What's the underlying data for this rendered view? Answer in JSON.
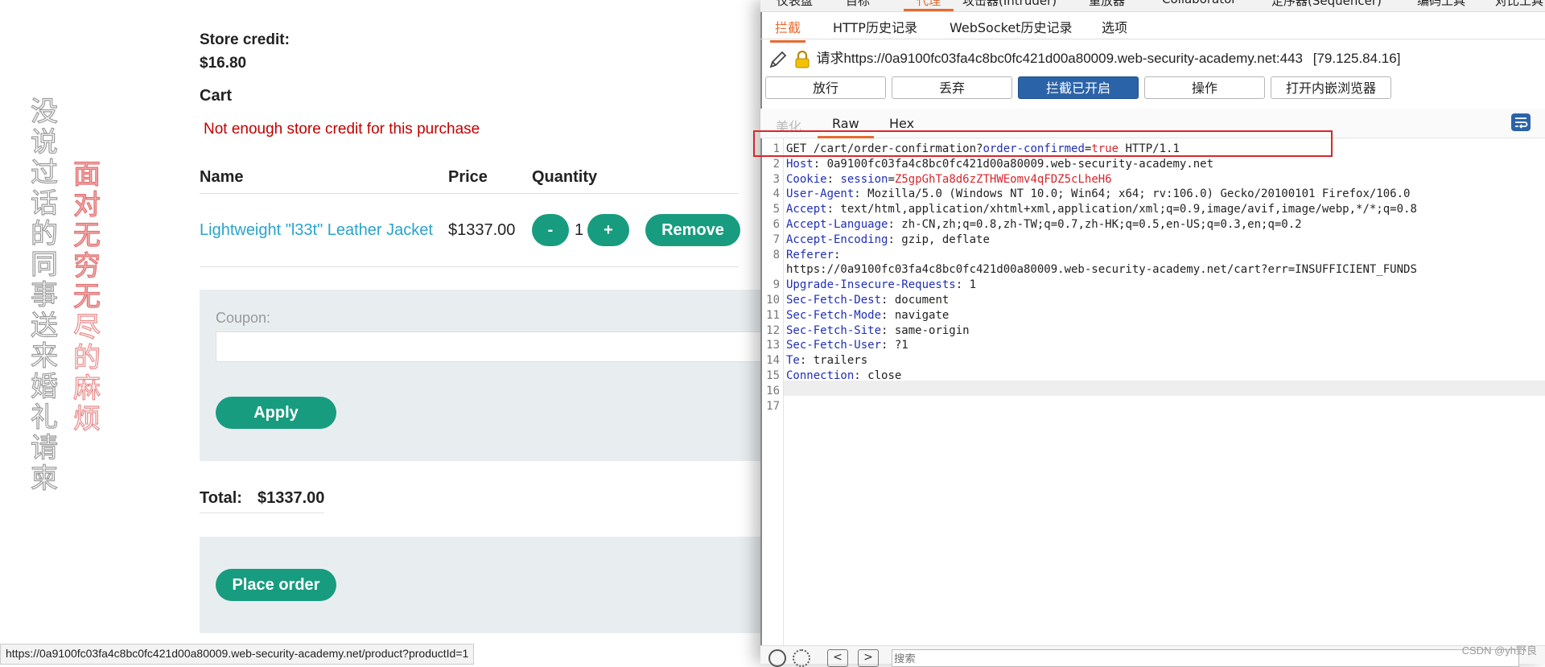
{
  "overlay_text": {
    "grey_column": [
      "没",
      "说",
      "过",
      "话",
      "的",
      "同",
      "事",
      "送",
      "来",
      "婚",
      "礼",
      "请",
      "柬"
    ],
    "red_column": [
      "面",
      "对",
      "无",
      "穷",
      "无",
      "尽",
      "的",
      "麻",
      "烦"
    ]
  },
  "shop": {
    "store_credit_label": "Store credit:",
    "store_credit_value": "$16.80",
    "cart_title": "Cart",
    "error_message": "Not enough store credit for this purchase",
    "table_headers": {
      "name": "Name",
      "price": "Price",
      "quantity": "Quantity"
    },
    "item": {
      "name": "Lightweight \"l33t\" Leather Jacket",
      "price": "$1337.00",
      "minus_label": "-",
      "quantity": "1",
      "plus_label": "+",
      "remove_label": "Remove"
    },
    "coupon_label": "Coupon:",
    "apply_label": "Apply",
    "total_label": "Total:",
    "total_value": "$1337.00",
    "place_order_label": "Place order",
    "status_url": "https://0a9100fc03fa4c8bc0fc421d00a80009.web-security-academy.net/product?productId=1"
  },
  "burp": {
    "main_tabs": [
      "仪表盘",
      "目标",
      "代理",
      "攻击器(Intruder)",
      "重放器",
      "Collaborator",
      "定序器(Sequencer)",
      "编码工具",
      "对比工具"
    ],
    "active_main_tab": "代理",
    "sub_tabs": [
      "拦截",
      "HTTP历史记录",
      "WebSocket历史记录",
      "选项"
    ],
    "request_label": "请求https://0a9100fc03fa4c8bc0fc421d00a80009.web-security-academy.net:443",
    "request_ip": "[79.125.84.16]",
    "buttons": {
      "forward": "放行",
      "drop": "丢弃",
      "intercept": "拦截已开启",
      "action": "操作",
      "browser": "打开内嵌浏览器"
    },
    "editor_tabs": {
      "pretty": "美化",
      "raw": "Raw",
      "hex": "Hex"
    },
    "lines": {
      "l1": {
        "method": "GET /cart/order-confirmation?",
        "param": "order-confirmed",
        "eq": "=",
        "val": "true",
        "rest": " HTTP/1.1"
      },
      "l2": {
        "k": "Host",
        "v": ": 0a9100fc03fa4c8bc0fc421d00a80009.web-security-academy.net"
      },
      "l3": {
        "k": "Cookie",
        "sep": ": ",
        "ck": "session",
        "eq": "=",
        "cv": "Z5gpGhTa8d6zZTHWEomv4qFDZ5cLheH6"
      },
      "l4": {
        "k": "User-Agent",
        "v": ": Mozilla/5.0 (Windows NT 10.0; Win64; x64; rv:106.0) Gecko/20100101 Firefox/106.0"
      },
      "l5": {
        "k": "Accept",
        "v": ": text/html,application/xhtml+xml,application/xml;q=0.9,image/avif,image/webp,*/*;q=0.8"
      },
      "l6": {
        "k": "Accept-Language",
        "v": ": zh-CN,zh;q=0.8,zh-TW;q=0.7,zh-HK;q=0.5,en-US;q=0.3,en;q=0.2"
      },
      "l7": {
        "k": "Accept-Encoding",
        "v": ": gzip, deflate"
      },
      "l8": {
        "k": "Referer",
        "v": ":"
      },
      "l8b": {
        "v": "https://0a9100fc03fa4c8bc0fc421d00a80009.web-security-academy.net/cart?err=INSUFFICIENT_FUNDS"
      },
      "l9": {
        "k": "Upgrade-Insecure-Requests",
        "v": ": 1"
      },
      "l10": {
        "k": "Sec-Fetch-Dest",
        "v": ": document"
      },
      "l11": {
        "k": "Sec-Fetch-Mode",
        "v": ": navigate"
      },
      "l12": {
        "k": "Sec-Fetch-Site",
        "v": ": same-origin"
      },
      "l13": {
        "k": "Sec-Fetch-User",
        "v": ": ?1"
      },
      "l14": {
        "k": "Te",
        "v": ": trailers"
      },
      "l15": {
        "k": "Connection",
        "v": ": close"
      }
    },
    "line_numbers": [
      "1",
      "2",
      "3",
      "4",
      "5",
      "6",
      "7",
      "8",
      "9",
      "10",
      "11",
      "12",
      "13",
      "14",
      "15",
      "16",
      "17"
    ],
    "search_placeholder": "搜索",
    "nav_prev": "<",
    "nav_next": ">",
    "watermark": "CSDN @yh野良"
  },
  "colors": {
    "accent_green": "#189c7f",
    "link_blue": "#29a3cc",
    "error_red": "#c00000",
    "burp_orange": "#e8692f",
    "burp_blue": "#2b63a8",
    "highlight_red": "#d9262b"
  }
}
